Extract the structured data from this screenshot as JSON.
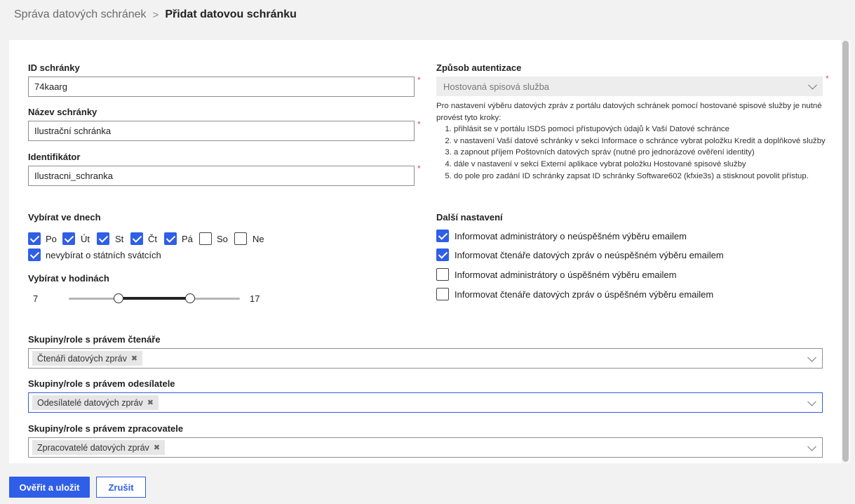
{
  "breadcrumb": {
    "parent": "Správa datových schránek",
    "separator": ">",
    "current": "Přidat datovou schránku"
  },
  "form": {
    "mailbox_id": {
      "label": "ID schránky",
      "value": "74kaarg",
      "required": "*"
    },
    "mailbox_name": {
      "label": "Název schránky",
      "value": "Ilustrační schránka",
      "required": "*"
    },
    "identifier": {
      "label": "Identifikátor",
      "value": "Ilustracni_schranka",
      "required": "*"
    },
    "auth": {
      "label": "Způsob autentizace",
      "value": "Hostovaná spisová služba",
      "required": "*",
      "intro": "Pro nastavení výběru datových zpráv z portálu datových schránek pomocí hostované spisové služby je nutné provést tyto kroky:",
      "steps": [
        "přihlásit se v portálu ISDS pomocí přístupových údajů k Vaší Datové schránce",
        "v nastavení Vaší datové schránky v sekci Informace o schránce vybrat položku Kredit a doplňkové služby",
        "a zapnout příjem Poštovních datových správ (nutné pro jednorázové ověření identity)",
        "dále v nastavení v sekci Externí aplikace vybrat položku Hostované spisové služby",
        "do pole pro zadání ID schránky zapsat ID schránky Software602 (kfxie3s) a stisknout povolit přístup."
      ]
    },
    "days": {
      "label": "Vybírat ve dnech",
      "items": [
        {
          "label": "Po",
          "checked": true
        },
        {
          "label": "Út",
          "checked": true
        },
        {
          "label": "St",
          "checked": true
        },
        {
          "label": "Čt",
          "checked": true
        },
        {
          "label": "Pá",
          "checked": true
        },
        {
          "label": "So",
          "checked": false
        },
        {
          "label": "Ne",
          "checked": false
        }
      ],
      "holidays": {
        "label": "nevybírat o státních svátcích",
        "checked": true
      }
    },
    "hours": {
      "label": "Vybírat v hodinách",
      "min": "7",
      "max": "17",
      "low": 7,
      "high": 17,
      "range_low": 0,
      "range_high": 24
    },
    "other": {
      "label": "Další nastavení",
      "items": [
        {
          "label": "Informovat administrátory o neúspěšném výběru emailem",
          "checked": true
        },
        {
          "label": "Informovat čtenáře datových zpráv o neúspěšném výběru emailem",
          "checked": true
        },
        {
          "label": "Informovat administrátory o úspěšném výběru emailem",
          "checked": false
        },
        {
          "label": "Informovat čtenáře datových zpráv o úspěšném výběru emailem",
          "checked": false
        }
      ]
    },
    "readers": {
      "label": "Skupiny/role s právem čtenáře",
      "tag": "Čtenáři datových zpráv"
    },
    "senders": {
      "label": "Skupiny/role s právem odesílatele",
      "tag": "Odesílatelé datových zpráv"
    },
    "processors": {
      "label": "Skupiny/role s právem zpracovatele",
      "tag": "Zpracovatelé datových zpráv"
    }
  },
  "buttons": {
    "submit": "Ověřit a uložit",
    "cancel": "Zrušit"
  },
  "colors": {
    "accent": "#2f5ee8",
    "required": "#d9534f"
  }
}
